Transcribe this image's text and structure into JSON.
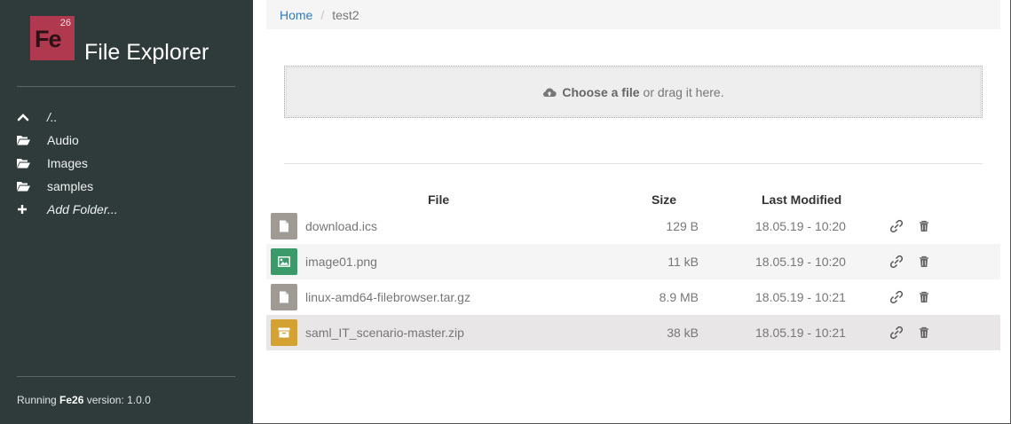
{
  "app": {
    "logo_symbol": "Fe",
    "logo_number": "26",
    "title": "File Explorer"
  },
  "sidebar": {
    "items": [
      {
        "icon": "chevron-up-icon",
        "label": "/.."
      },
      {
        "icon": "folder-open-icon",
        "label": "Audio"
      },
      {
        "icon": "folder-open-icon",
        "label": "Images"
      },
      {
        "icon": "folder-open-icon",
        "label": "samples"
      },
      {
        "icon": "plus-icon",
        "label": "Add Folder..."
      }
    ],
    "footer_prefix": "Running ",
    "footer_brand": "Fe26",
    "footer_suffix": " version: 1.0.0"
  },
  "breadcrumb": {
    "home": "Home",
    "separator": "/",
    "current": "test2"
  },
  "dropzone": {
    "choose": "Choose a file",
    "rest": "or drag it here.",
    "icon": "cloud-upload-icon"
  },
  "table": {
    "headers": {
      "file": "File",
      "size": "Size",
      "modified": "Last Modified"
    },
    "rows": [
      {
        "name": "download.ics",
        "size": "129 B",
        "modified": "18.05.19 - 10:20",
        "type": "file",
        "color": "#a09a94"
      },
      {
        "name": "image01.png",
        "size": "11 kB",
        "modified": "18.05.19 - 10:20",
        "type": "image",
        "color": "#3a9a6a"
      },
      {
        "name": "linux-amd64-filebrowser.tar.gz",
        "size": "8.9 MB",
        "modified": "18.05.19 - 10:21",
        "type": "file",
        "color": "#a09a94"
      },
      {
        "name": "saml_IT_scenario-master.zip",
        "size": "38 kB",
        "modified": "18.05.19 - 10:21",
        "type": "archive",
        "color": "#d4a233"
      }
    ]
  },
  "colors": {
    "sidebar_bg": "#2e3b3a",
    "logo_bg": "#b0384f",
    "link": "#337ab7"
  }
}
